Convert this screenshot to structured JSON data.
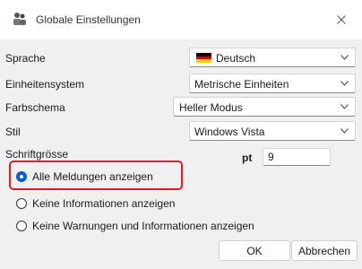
{
  "window": {
    "title": "Globale Einstellungen",
    "app_icon": "people-icon",
    "close_icon": "close-icon"
  },
  "settings": {
    "language": {
      "label": "Sprache",
      "value": "Deutsch",
      "flag": "germany-flag-icon"
    },
    "units": {
      "label": "Einheitensystem",
      "value": "Metrische Einheiten"
    },
    "color_scheme": {
      "label": "Farbschema",
      "value": "Heller Modus"
    },
    "style": {
      "label": "Stil",
      "value": "Windows Vista"
    },
    "font_size": {
      "label": "Schriftgrösse",
      "unit": "pt",
      "value": "9"
    }
  },
  "messages": {
    "options": [
      {
        "label": "Alle Meldungen anzeigen",
        "checked": true
      },
      {
        "label": "Keine Informationen anzeigen",
        "checked": false
      },
      {
        "label": "Keine Warnungen und Informationen anzeigen",
        "checked": false
      }
    ]
  },
  "buttons": {
    "ok": "OK",
    "cancel": "Abbrechen"
  },
  "colors": {
    "accent": "#0b5cd5",
    "highlight": "#e01b24"
  }
}
